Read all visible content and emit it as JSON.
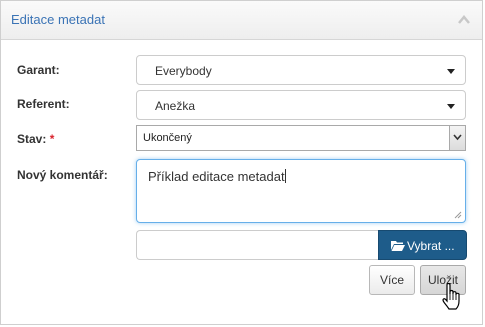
{
  "panel": {
    "title": "Editace metadat"
  },
  "form": {
    "garant": {
      "label": "Garant:",
      "value": "Everybody"
    },
    "referent": {
      "label": "Referent:",
      "value": "Anežka"
    },
    "stav": {
      "label": "Stav:",
      "required_mark": "*",
      "value": "Ukončený"
    },
    "comment": {
      "label": "Nový komentář:",
      "value": "Příklad editace metadat"
    },
    "file": {
      "button_label": "Vybrat ..."
    }
  },
  "actions": {
    "more_label": "Více",
    "save_label": "Uložit"
  },
  "colors": {
    "accent": "#3a73b5",
    "primary_button": "#1e5c8a",
    "required": "#d9232d"
  }
}
